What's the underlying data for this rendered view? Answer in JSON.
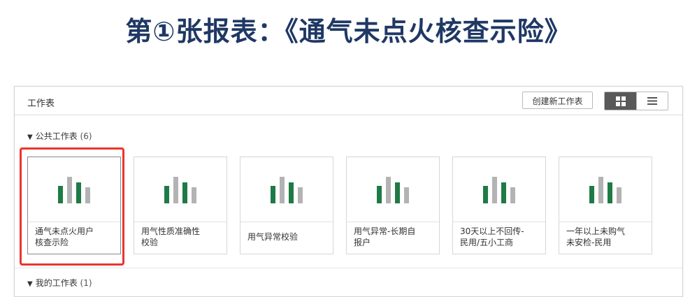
{
  "heading": "第①张报表：《通气未点火核查示险》",
  "panel": {
    "title": "工作表",
    "create_button": "创建新工作表",
    "view_toggle": {
      "active": "grid",
      "grid_icon": "grid-icon",
      "list_icon": "list-icon"
    }
  },
  "public_section": {
    "arrow": "▼",
    "title": "公共工作表",
    "count": "(6)"
  },
  "my_section": {
    "arrow": "▼",
    "title": "我的工作表",
    "count": "(1)"
  },
  "colors": {
    "bar_green": "#1e7b45",
    "bar_gray": "#b3b3b3",
    "highlight": "#e8352e",
    "heading": "#1f3864"
  },
  "sheets": [
    {
      "label_line1": "通气未点火用户",
      "label_line2": "核查示险",
      "selected": true
    },
    {
      "label_line1": "用气性质准确性",
      "label_line2": "校验",
      "selected": false
    },
    {
      "label_line1": "用气异常校验",
      "label_line2": "",
      "selected": false
    },
    {
      "label_line1": "用气异常-长期自",
      "label_line2": "报户",
      "selected": false
    },
    {
      "label_line1": "30天以上不回传-",
      "label_line2": "民用/五小工商",
      "selected": false
    },
    {
      "label_line1": "一年以上未购气",
      "label_line2": "未安检-民用",
      "selected": false
    }
  ]
}
